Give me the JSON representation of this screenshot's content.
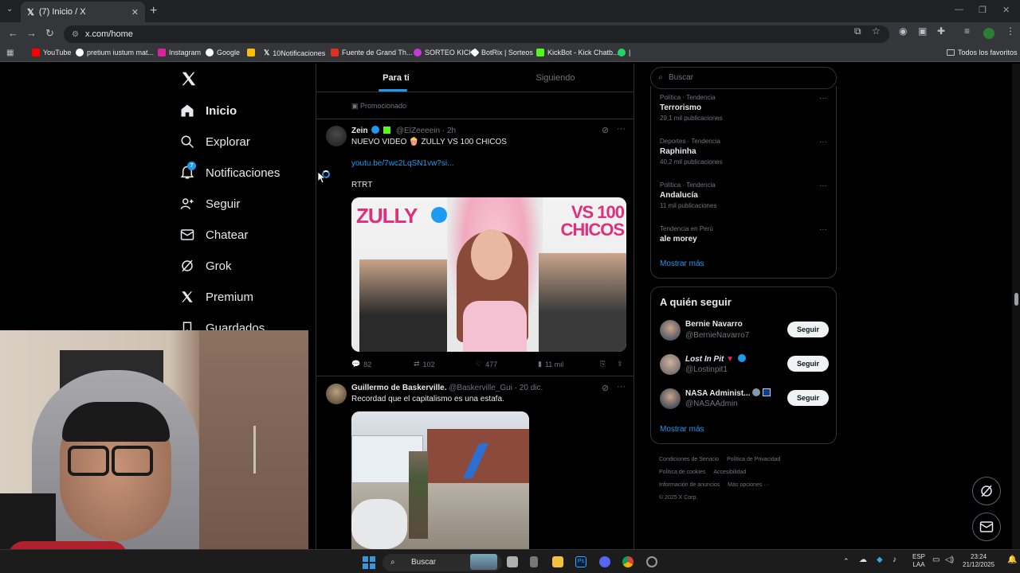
{
  "browser": {
    "tab_title": "(7) Inicio / X",
    "tab_close": "✕",
    "new_tab": "+",
    "url": "x.com/home",
    "bookmarks": [
      {
        "label": "YouTube",
        "color": "#ff0000"
      },
      {
        "label": "pretium iustum mat...",
        "color": "#ffffff"
      },
      {
        "label": "Instagram",
        "color": "#d6249f"
      },
      {
        "label": "Google",
        "color": "#ffffff"
      },
      {
        "label": "",
        "color": "#fbbc05"
      },
      {
        "label": "10Notificaciones",
        "color": "#000000"
      },
      {
        "label": "Fuente de Grand Th...",
        "color": "#e0301e"
      },
      {
        "label": "SORTEO KICK",
        "color": "#c43bd1"
      },
      {
        "label": "BotRix | Sorteos",
        "color": "#ffffff"
      },
      {
        "label": "KickBot - Kick Chatb...",
        "color": "#53fc18"
      },
      {
        "label": "|",
        "color": "#25d366"
      }
    ],
    "all_bookmarks": "Todos los favoritos"
  },
  "sidebar": {
    "items": [
      {
        "label": "Inicio",
        "icon": "home-icon"
      },
      {
        "label": "Explorar",
        "icon": "search-icon"
      },
      {
        "label": "Notificaciones",
        "icon": "bell-icon",
        "badge": "7"
      },
      {
        "label": "Seguir",
        "icon": "add-person-icon"
      },
      {
        "label": "Chatear",
        "icon": "mail-icon"
      },
      {
        "label": "Grok",
        "icon": "grok-icon"
      },
      {
        "label": "Premium",
        "icon": "x-icon"
      },
      {
        "label": "Guardados",
        "icon": "bookmark-icon"
      }
    ]
  },
  "feed": {
    "tabs": [
      "Para ti",
      "Siguiendo"
    ],
    "promoted": "Promocionado",
    "tweets": [
      {
        "name": "Zein",
        "handle": "@ElZeeeein",
        "time": "· 2h",
        "text": "NUEVO VIDEO 🍿 ZULLY VS 100 CHICOS",
        "link": "youtu.be/7wc2LqSN1vw?si...",
        "extra": "RTRT",
        "media_title_left": "ZULLY",
        "media_title_right": "VS 100 CHICOS",
        "replies": "82",
        "retweets": "102",
        "likes": "477",
        "views": "11 mil"
      },
      {
        "name": "Guillermo de Baskerville.",
        "handle": "@Baskerville_Gui",
        "time": "· 20 dic.",
        "text": "Recordad que el capitalismo es una estafa."
      }
    ]
  },
  "right": {
    "search_placeholder": "Buscar",
    "trends": [
      {
        "category": "Política · Tendencia",
        "title": "Terrorismo",
        "count": "29,1 mil publicaciones"
      },
      {
        "category": "Deportes · Tendencia",
        "title": "Raphinha",
        "count": "40,2 mil publicaciones"
      },
      {
        "category": "Política · Tendencia",
        "title": "Andalucía",
        "count": "11 mil publicaciones"
      },
      {
        "category": "Tendencia en Perú",
        "title": "ale morey",
        "count": ""
      }
    ],
    "show_more": "Mostrar más",
    "follow_title": "A quién seguir",
    "follow": [
      {
        "name": "Bernie Navarro",
        "handle": "@BernieNavarro7",
        "button": "Seguir"
      },
      {
        "name": "Lost In Pit",
        "handle": "@Lostinpit1",
        "button": "Seguir"
      },
      {
        "name": "NASA Administ...",
        "handle": "@NASAAdmin",
        "button": "Seguir"
      }
    ],
    "follow_show_more": "Mostrar más",
    "footer": [
      "Condiciones de Servicio",
      "Política de Privacidad",
      "Política de cookies",
      "Accesibilidad",
      "Información de anuncios",
      "Más opciones ···",
      "© 2025 X Corp."
    ]
  },
  "taskbar": {
    "search": "Buscar",
    "lang1": "ESP",
    "lang2": "LAA",
    "time": "23:24",
    "date": "21/12/2025"
  }
}
